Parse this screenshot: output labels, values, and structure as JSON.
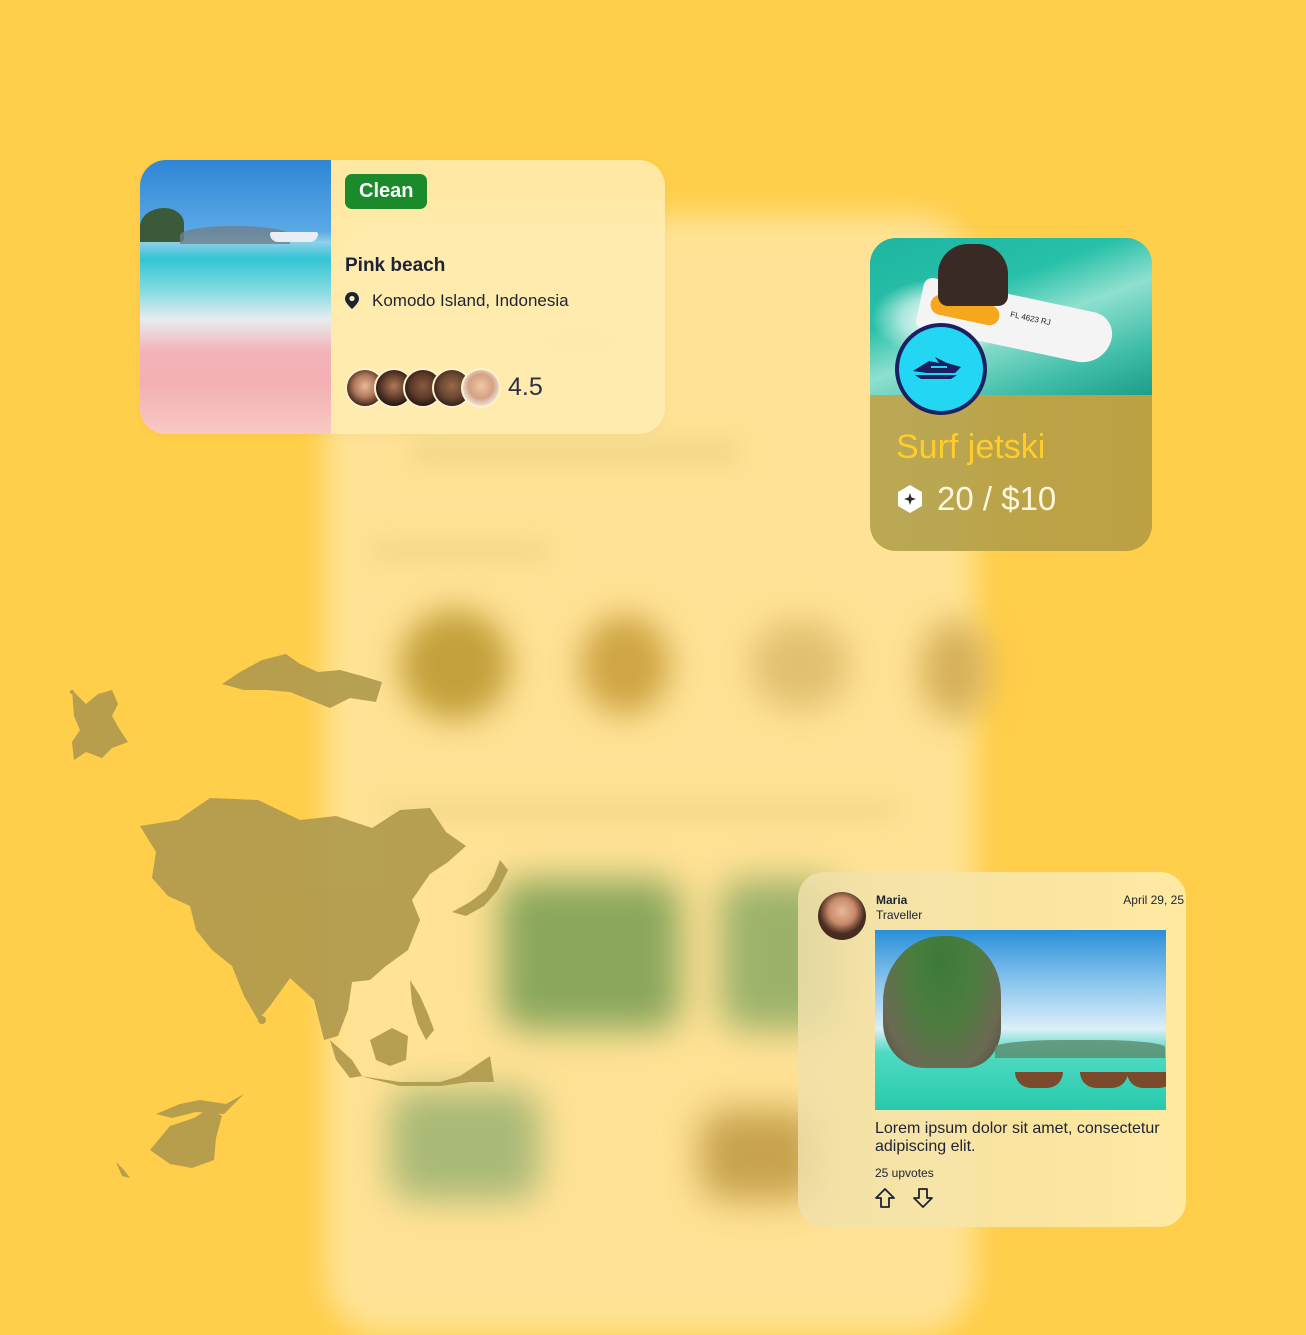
{
  "beach_card": {
    "badge": "Clean",
    "title": "Pink beach",
    "location": "Komodo Island, Indonesia",
    "rating": "4.5",
    "avatars": [
      "avatar-1",
      "avatar-2",
      "avatar-3",
      "avatar-4",
      "avatar-5"
    ],
    "badge_color": "#1b8a2a"
  },
  "activity_card": {
    "title": "Surf jetski",
    "price": "20 / $10",
    "photo_plate": "FL 4623 RJ",
    "title_color": "#ffcc2c",
    "logo_color": "#22d6f4"
  },
  "post_card": {
    "author": "Maria",
    "role": "Traveller",
    "date": "April 29, 25",
    "text": "Lorem ipsum dolor sit amet, consectetur adipiscing elit.",
    "upvotes": "25 upvotes"
  },
  "theme": {
    "background": "#ffce4a",
    "map_color": "#b09a4e"
  }
}
